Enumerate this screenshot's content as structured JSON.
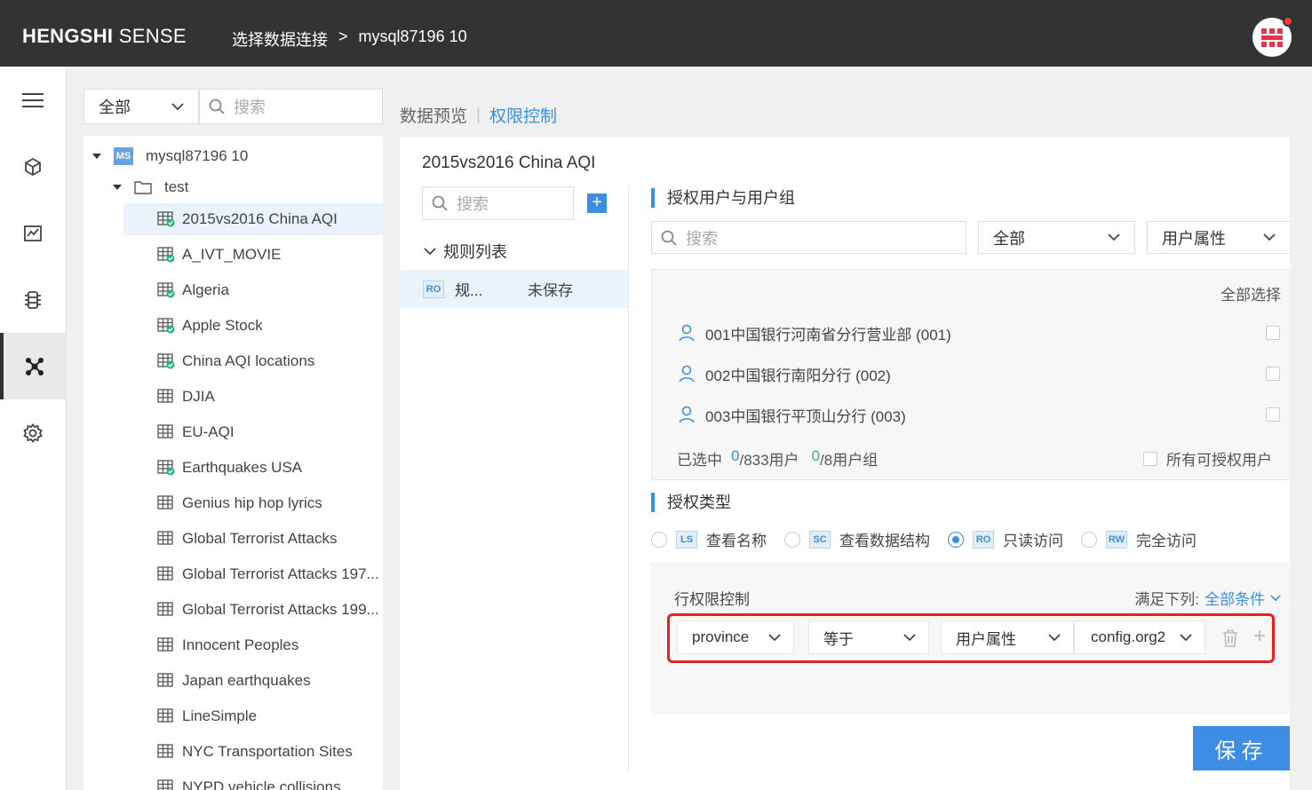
{
  "header": {
    "brand_bold": "HENGSHI",
    "brand_rest": " SENSE",
    "crumb_1": "选择数据连接",
    "crumb_sep": ">",
    "crumb_2": "mysql87196 10"
  },
  "leftnav": {
    "items": [
      "menu-icon",
      "cube-icon",
      "chart-icon",
      "dataset-icon",
      "connection-icon",
      "settings-icon"
    ],
    "active_index": 4
  },
  "tree_panel": {
    "filter_value": "全部",
    "search_placeholder": "搜索",
    "connection_badge": "MS",
    "connection_name": "mysql87196 10",
    "folder_name": "test",
    "tables": [
      {
        "name": "2015vs2016 China AQI",
        "secured": true
      },
      {
        "name": "A_IVT_MOVIE",
        "secured": true
      },
      {
        "name": "Algeria",
        "secured": true
      },
      {
        "name": "Apple Stock",
        "secured": true
      },
      {
        "name": "China AQI locations",
        "secured": true
      },
      {
        "name": "DJIA",
        "secured": false
      },
      {
        "name": "EU-AQI",
        "secured": false
      },
      {
        "name": "Earthquakes USA",
        "secured": true
      },
      {
        "name": "Genius hip hop lyrics",
        "secured": false
      },
      {
        "name": "Global Terrorist Attacks",
        "secured": false
      },
      {
        "name": "Global Terrorist Attacks 197...",
        "secured": false
      },
      {
        "name": "Global Terrorist Attacks 199...",
        "secured": false
      },
      {
        "name": "Innocent Peoples",
        "secured": false
      },
      {
        "name": "Japan earthquakes",
        "secured": false
      },
      {
        "name": "LineSimple",
        "secured": false
      },
      {
        "name": "NYC Transportation Sites",
        "secured": false
      },
      {
        "name": "NYPD vehicle collisions",
        "secured": false
      }
    ]
  },
  "tabs": {
    "preview": "数据预览",
    "sep": "|",
    "permission": "权限控制"
  },
  "main": {
    "table_title": "2015vs2016 China AQI",
    "rule_search_placeholder": "搜索",
    "add_rule": "+",
    "rule_list_label": "规则列表",
    "rule": {
      "badge": "RO",
      "name": "规...",
      "status": "未保存"
    },
    "users_section_title": "授权用户与用户组",
    "user_search_placeholder": "搜索",
    "user_filter": "全部",
    "user_attr_filter": "用户属性",
    "select_all": "全部选择",
    "users": [
      "001中国银行河南省分行营业部 (001)",
      "002中国银行南阳分行 (002)",
      "003中国银行平顶山分行 (003)"
    ],
    "summary": {
      "label": "已选中",
      "users_selected": "0",
      "users_total": "/833用户",
      "groups_selected": "0",
      "groups_total": "/8用户组"
    },
    "all_authorizable": "所有可授权用户",
    "auth_type_title": "授权类型",
    "auth_types": [
      {
        "badge": "LS",
        "label": "查看名称",
        "selected": false
      },
      {
        "badge": "SC",
        "label": "查看数据结构",
        "selected": false
      },
      {
        "badge": "RO",
        "label": "只读访问",
        "selected": true
      },
      {
        "badge": "RW",
        "label": "完全访问",
        "selected": false
      }
    ],
    "row_permission_label": "行权限控制",
    "condition_label": "满足下列:",
    "condition_value": "全部条件",
    "filter_row": {
      "field": "province",
      "operator": "等于",
      "value_type": "用户属性",
      "value": "config.org2"
    },
    "save_label": "保存"
  }
}
